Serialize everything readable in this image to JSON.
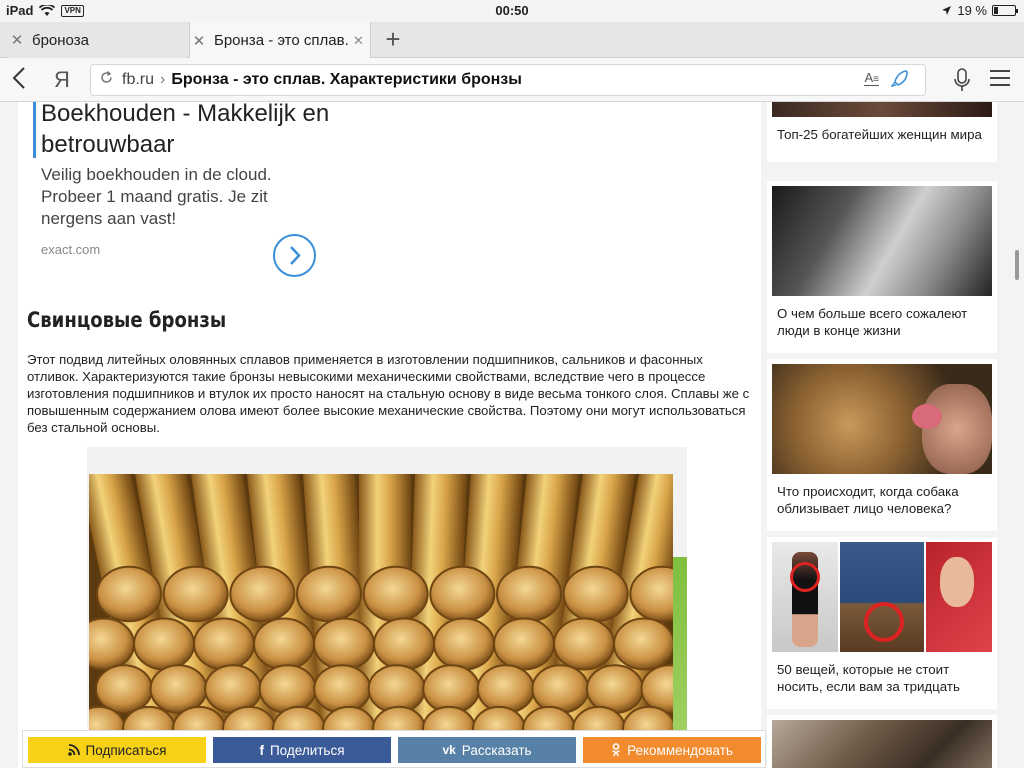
{
  "status_bar": {
    "device": "iPad",
    "vpn": "VPN",
    "time": "00:50",
    "battery": "19 %",
    "battery_level": 0.19
  },
  "tabs": [
    {
      "label": "броноза",
      "active": false
    },
    {
      "label": "Бронза - это сплав.",
      "active": true
    }
  ],
  "toolbar": {
    "yandex_logo": "Я",
    "domain": "fb.ru",
    "separator": "›",
    "page_title": "Бронза - это сплав. Характеристики бронзы",
    "reader_icon": "A̲"
  },
  "ad": {
    "title": "Boekhouden - Makkelijk en betrouwbaar",
    "description": "Veilig boekhouden in de cloud. Probeer 1 maand gratis. Je zit nergens aan vast!",
    "source": "exact.com"
  },
  "article": {
    "heading": "Свинцовые бронзы",
    "paragraph": "Этот подвид литейных оловянных сплавов применяется в изготовлении подшипников, сальников и фасонных отливок. Характеризуются такие бронзы невысокими механическими свойствами, вследствие чего в процессе изготовления подшипников и втулок их просто наносят на стальную основу в виде весьма тонкого слоя. Сплавы же с повышенным содержанием олова имеют более высокие механические свойства. Поэтому они могут использоваться без стальной основы."
  },
  "share_bar": {
    "subscribe": "Подписаться",
    "share": "Поделиться",
    "tell": "Рассказать",
    "recommend": "Рекоммендовать"
  },
  "sidebar": [
    {
      "caption": "Топ-25 богатейших женщин мира"
    },
    {
      "caption": "О чем больше всего сожалеют люди в конце жизни"
    },
    {
      "caption": "Что происходит, когда собака облизывает лицо человека?"
    },
    {
      "caption": "50 вещей, которые не стоит носить, если вам за тридцать"
    },
    {
      "caption": ""
    }
  ],
  "colors": {
    "accent": "#3a8fd8",
    "subscribe": "#f7d117",
    "facebook": "#3b5a98",
    "vk": "#5781a6",
    "ok": "#f28a2e"
  }
}
